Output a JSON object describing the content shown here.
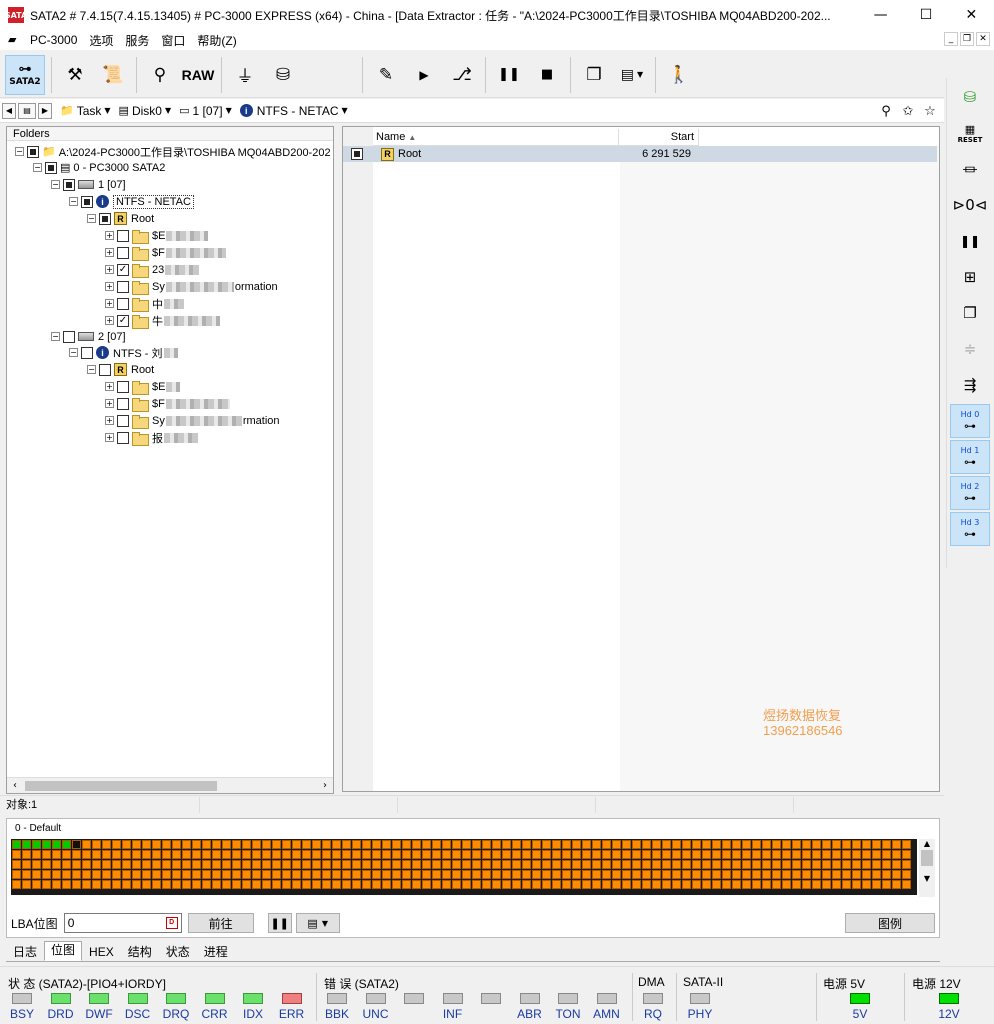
{
  "window": {
    "title": "SATA2 # 7.4.15(7.4.15.13405) # PC-3000 EXPRESS (x64) - China - [Data Extractor : 任务 - \"A:\\2024-PC3000工作目录\\TOSHIBA MQ04ABD200-202...",
    "app_icon_text": "SATA"
  },
  "menu": {
    "items": [
      "PC-3000",
      "选项",
      "服务",
      "窗口",
      "帮助(Z)"
    ]
  },
  "toolbar": {
    "sata2_label": "SATA2",
    "raw_label": "RAW"
  },
  "nav": {
    "task": "Task",
    "disk": "Disk0",
    "partition": "1 [07]",
    "fs": "NTFS - NETAC"
  },
  "folders": {
    "header": "Folders",
    "root_path": "A:\\2024-PC3000工作目录\\TOSHIBA MQ04ABD200-202",
    "drive": "0 - PC3000 SATA2",
    "part1": "1 [07]",
    "fs1": "NTFS - NETAC",
    "root1": "Root",
    "p1_items": [
      "$E",
      "$F",
      "23",
      "Sy",
      "中",
      "牛"
    ],
    "p1_suffix": [
      "",
      "",
      "",
      "ormation",
      "",
      ""
    ],
    "part2": "2 [07]",
    "fs2": "NTFS - 刘",
    "root2": "Root",
    "p2_items": [
      "$E",
      "$F",
      "Sy",
      "报"
    ],
    "p2_suffix": [
      "",
      "",
      "rmation",
      ""
    ]
  },
  "list": {
    "col_name": "Name",
    "col_start": "Start",
    "row_name": "Root",
    "row_start": "6 291 529"
  },
  "watermark": {
    "line1": "煜扬数据恢复",
    "line2": "13962186546"
  },
  "status": {
    "objects": "对象:1"
  },
  "map": {
    "label": "0 - Default",
    "read_blocks": 7,
    "colors": {
      "good": "#00cc00",
      "read": "#ff8c00",
      "current": "#111111",
      "grid": "#1a1a1a"
    }
  },
  "lba": {
    "label": "LBA位图",
    "value": "0",
    "go_label": "前往",
    "legend_label": "图例"
  },
  "tabs": [
    "日志",
    "位图",
    "HEX",
    "结构",
    "状态",
    "进程"
  ],
  "indicators": {
    "status_label": "状 态 (SATA2)-[PIO4+IORDY]",
    "error_label": "错 误 (SATA2)",
    "dma_label": "DMA",
    "sataii_label": "SATA-II",
    "power5_label": "电源 5V",
    "power12_label": "电源 12V",
    "status_leds": [
      {
        "name": "BSY",
        "state": "off"
      },
      {
        "name": "DRD",
        "state": "on"
      },
      {
        "name": "DWF",
        "state": "on"
      },
      {
        "name": "DSC",
        "state": "on"
      },
      {
        "name": "DRQ",
        "state": "on"
      },
      {
        "name": "CRR",
        "state": "on"
      },
      {
        "name": "IDX",
        "state": "on"
      },
      {
        "name": "ERR",
        "state": "err"
      }
    ],
    "error_leds": [
      "BBK",
      "UNC",
      "",
      "INF",
      "",
      "ABR",
      "TON",
      "AMN"
    ],
    "dma_leds": [
      "RQ"
    ],
    "sataii_leds": [
      "PHY"
    ],
    "p5": "5V",
    "p12": "12V"
  }
}
